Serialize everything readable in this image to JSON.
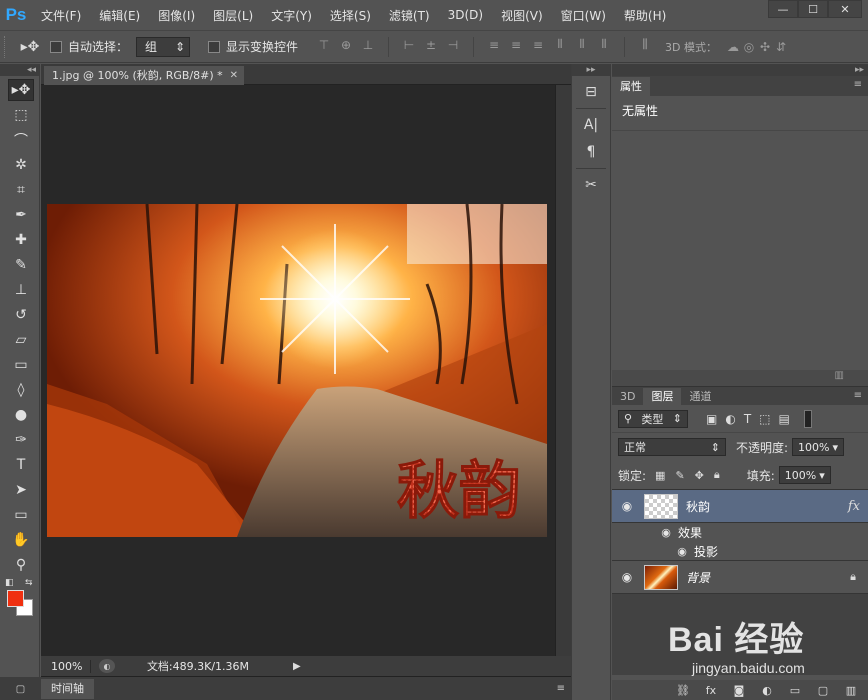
{
  "app": {
    "logo": "Ps"
  },
  "menu": [
    "文件(F)",
    "编辑(E)",
    "图像(I)",
    "图层(L)",
    "文字(Y)",
    "选择(S)",
    "滤镜(T)",
    "3D(D)",
    "视图(V)",
    "窗口(W)",
    "帮助(H)"
  ],
  "window_controls": {
    "minimize": "—",
    "maximize": "☐",
    "close": "✕"
  },
  "options": {
    "auto_select_label": "自动选择：",
    "auto_select_value": "组",
    "show_transform_label": "显示变换控件",
    "mode_3d_label": "3D 模式："
  },
  "document": {
    "tab_title": "1.jpg @ 100% (秋韵, RGB/8#) *",
    "tab_close": "✕",
    "canvas_text": "秋韵",
    "zoom": "100%",
    "doc_info": "文档:489.3K/1.36M"
  },
  "timeline": {
    "tab": "时间轴"
  },
  "properties": {
    "tab": "属性",
    "body": "无属性"
  },
  "layers_panel": {
    "tabs": [
      "3D",
      "图层",
      "通道"
    ],
    "active_tab": "图层",
    "filter_type": "类型",
    "blend_mode": "正常",
    "opacity_label": "不透明度:",
    "opacity_value": "100%",
    "lock_label": "锁定:",
    "fill_label": "填充:",
    "fill_value": "100%",
    "layers": [
      {
        "name": "秋韵",
        "fx": "fx",
        "effects_label": "效果",
        "effect": "投影"
      },
      {
        "name": "背景"
      }
    ]
  },
  "watermark": {
    "main": "Bai 经验",
    "sub": "jingyan.baidu.com"
  },
  "colors": {
    "foreground": "#f03010",
    "background": "#ffffff",
    "selected_layer": "#5a6a84"
  }
}
